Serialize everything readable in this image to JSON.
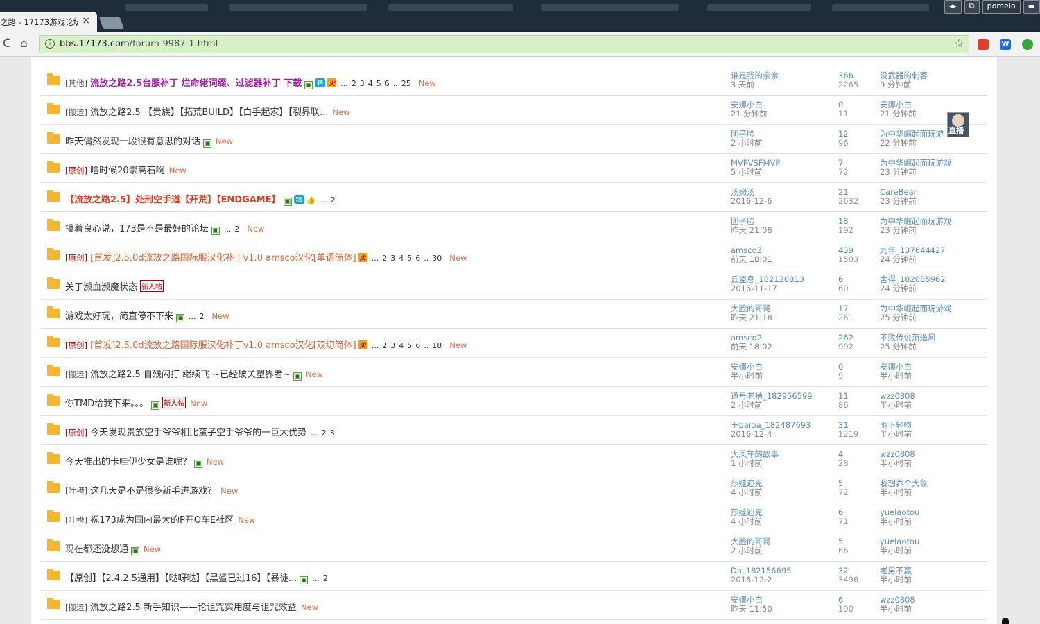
{
  "browser": {
    "tab_title": "之路 - 17173游戏论坛",
    "tab_close": "×",
    "user_button": "pomelo",
    "minimize": "▬",
    "url_host": "bbs.17173.com",
    "url_path": "/forum-9987-1.html",
    "reload_glyph": "C",
    "home_glyph": "⌂",
    "info_glyph": "i",
    "star_glyph": "☆"
  },
  "labels": {
    "new": "New",
    "newbie": "新人帖",
    "digest": "精",
    "hot": "火",
    "img": "▣",
    "live": "直播"
  },
  "threads": [
    {
      "cat": "[其他]",
      "cat_red": false,
      "title": "流放之路2.5台服补丁 烂命佬词缀、过滤器补丁 下载",
      "style": "purple",
      "img": true,
      "digest": true,
      "hot": true,
      "pages": [
        "...",
        "2",
        "3",
        "4",
        "5",
        "6",
        "..",
        "25"
      ],
      "new": true,
      "author": "谁是我的亲亲",
      "date": "3 天前",
      "replies": "366",
      "views": "2265",
      "last_by": "没武器的刺客",
      "last_time": "9 分钟前"
    },
    {
      "cat": "[搬运]",
      "cat_red": false,
      "title": "流放之路2.5 【贵族】【拓荒BUILD】【白手起家】【裂界联...",
      "style": "",
      "img": false,
      "pages": [],
      "new": true,
      "author": "安娜小白",
      "date": "21 分钟前",
      "replies": "0",
      "views": "11",
      "last_by": "安娜小白",
      "last_time": "21 分钟前"
    },
    {
      "cat": "",
      "title": "昨天偶然发现一段很有意思的对话",
      "style": "",
      "img": true,
      "pages": [],
      "new": true,
      "author": "团子脸",
      "date": "2 小时前",
      "replies": "12",
      "views": "96",
      "last_by": "为中华崛起而玩游",
      "last_time": "22 分钟前"
    },
    {
      "cat": "[原创]",
      "cat_red": true,
      "title": "啥时候20崇高石啊",
      "style": "",
      "img": false,
      "pages": [],
      "new": true,
      "author": "MVPVSFMVP",
      "date": "5 小时前",
      "replies": "7",
      "views": "72",
      "last_by": "为中华崛起而玩游戏",
      "last_time": "23 分钟前"
    },
    {
      "cat": "",
      "title": "【流放之路2.5】处刑空手道【开荒】【ENDGAME】",
      "style": "red",
      "img": true,
      "digest": true,
      "thumb": true,
      "pages": [
        "...",
        "2"
      ],
      "new": false,
      "author": "汤姆汤",
      "date": "2016-12-6",
      "replies": "21",
      "views": "2632",
      "last_by": "CareBear",
      "last_time": "23 分钟前"
    },
    {
      "cat": "",
      "title": "摸着良心说，173是不是最好的论坛",
      "style": "",
      "img": true,
      "pages": [
        "...",
        "2"
      ],
      "new": true,
      "author": "团子脸",
      "date": "昨天 21:08",
      "replies": "18",
      "views": "192",
      "last_by": "为中华崛起而玩游戏",
      "last_time": "23 分钟前"
    },
    {
      "cat": "[原创]",
      "cat_red": true,
      "title": "[首发]2.5.0d流放之路国际服汉化补丁v1.0 amsco汉化[单语简体]",
      "style": "orange",
      "img": false,
      "hot": true,
      "pages": [
        "...",
        "2",
        "3",
        "4",
        "5",
        "6",
        "..",
        "30"
      ],
      "new": true,
      "author": "amsco2",
      "date": "前天 18:01",
      "replies": "439",
      "views": "1503",
      "last_by": "九年_137644427",
      "last_time": "24 分钟前"
    },
    {
      "cat": "",
      "title": "关于濒血濒魔状态",
      "style": "",
      "img": false,
      "newbie": true,
      "pages": [],
      "new": false,
      "author": "丘盗息_182120813",
      "date": "2016-11-17",
      "replies": "6",
      "views": "60",
      "last_by": "舍得_182085962",
      "last_time": "24 分钟前"
    },
    {
      "cat": "",
      "title": "游戏太好玩，简直停不下来",
      "style": "",
      "img": true,
      "pages": [
        "...",
        "2"
      ],
      "new": true,
      "author": "大脸的哥哥",
      "date": "昨天 21:18",
      "replies": "17",
      "views": "261",
      "last_by": "为中华崛起而玩游戏",
      "last_time": "25 分钟前"
    },
    {
      "cat": "[原创]",
      "cat_red": true,
      "title": "[首发]2.5.0d流放之路国际服汉化补丁v1.0 amsco汉化[双切简体]",
      "style": "orange",
      "img": false,
      "hot": true,
      "pages": [
        "...",
        "2",
        "3",
        "4",
        "5",
        "6",
        "..",
        "18"
      ],
      "new": true,
      "author": "amsco2",
      "date": "前天 18:02",
      "replies": "262",
      "views": "992",
      "last_by": "不败传说萧逸风",
      "last_time": "25 分钟前"
    },
    {
      "cat": "[搬运]",
      "cat_red": false,
      "title": "流放之路2.5 自残闪打 继续飞 ~已经破关塑界者~",
      "style": "",
      "img": true,
      "pages": [],
      "new": true,
      "author": "安娜小白",
      "date": "半小时前",
      "replies": "0",
      "views": "9",
      "last_by": "安娜小白",
      "last_time": "半小时前"
    },
    {
      "cat": "",
      "title": "你TMD给我下来。。。",
      "style": "",
      "img": true,
      "newbie": true,
      "pages": [],
      "new": true,
      "author": "道号老衲_182956599",
      "date": "2 小时前",
      "replies": "11",
      "views": "86",
      "last_by": "wzz0808",
      "last_time": "半小时前"
    },
    {
      "cat": "[原创]",
      "cat_red": true,
      "title": "今天发现贵族空手爷爷相比蛮子空手爷爷的一巨大优势",
      "style": "",
      "img": false,
      "pages": [
        "...",
        "2",
        "3"
      ],
      "new": false,
      "author": "王baitia_182487693",
      "date": "2016-12-4",
      "replies": "31",
      "views": "1219",
      "last_by": "雨下轻吻",
      "last_time": "半小时前"
    },
    {
      "cat": "",
      "title": "今天推出的卡哇伊少女是谁呢？",
      "style": "",
      "img": true,
      "pages": [],
      "new": true,
      "author": "大风车的故事",
      "date": "1 小时前",
      "replies": "4",
      "views": "28",
      "last_by": "wzz0808",
      "last_time": "半小时前"
    },
    {
      "cat": "[吐槽]",
      "cat_red": false,
      "title": "这几天是不是很多新手进游戏？",
      "style": "",
      "img": false,
      "pages": [],
      "new": true,
      "author": "莎娃迪克",
      "date": "4 小时前",
      "replies": "5",
      "views": "72",
      "last_by": "我想养个大象",
      "last_time": "半小时前"
    },
    {
      "cat": "[吐槽]",
      "cat_red": false,
      "title": "祝173成为国内最大的P开O车E社区",
      "style": "",
      "img": false,
      "pages": [],
      "new": true,
      "author": "莎娃迪克",
      "date": "4 小时前",
      "replies": "6",
      "views": "71",
      "last_by": "yuelaotou",
      "last_time": "半小时前"
    },
    {
      "cat": "",
      "title": "现在都还没想通",
      "style": "",
      "img": true,
      "pages": [],
      "new": true,
      "author": "大脸的哥哥",
      "date": "2 小时前",
      "replies": "5",
      "views": "66",
      "last_by": "yuelaotou",
      "last_time": "半小时前"
    },
    {
      "cat": "",
      "title": "【原创】【2.4.2.5通用】【哒呀哒】【黑鲨已过16】【暴徒...",
      "style": "",
      "img": true,
      "pages": [
        "...",
        "2"
      ],
      "new": false,
      "author": "Da_182156695",
      "date": "2016-12-2",
      "replies": "32",
      "views": "3496",
      "last_by": "老男不赢",
      "last_time": "半小时前"
    },
    {
      "cat": "[搬运]",
      "cat_red": false,
      "title": "流放之路2.5 新手知识——论诅咒实用度与诅咒效益",
      "style": "",
      "img": false,
      "pages": [],
      "new": true,
      "author": "安娜小白",
      "date": "昨天 11:50",
      "replies": "6",
      "views": "190",
      "last_by": "wzz0808",
      "last_time": "半小时前"
    }
  ]
}
